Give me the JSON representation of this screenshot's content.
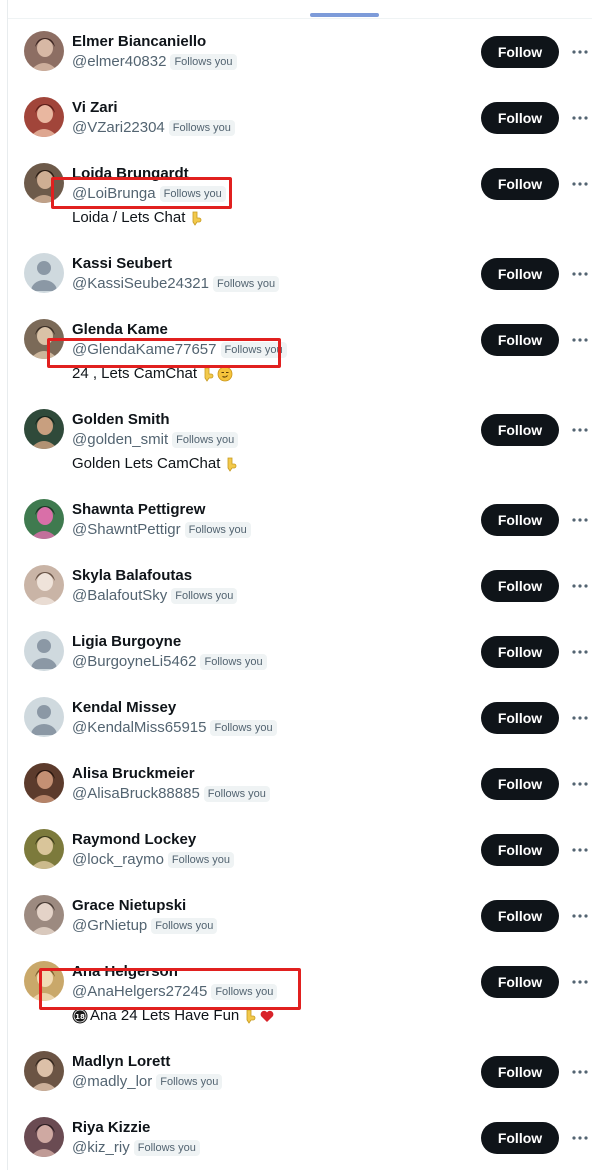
{
  "colors": {
    "follow_bg": "#0f1419",
    "follow_text": "#ffffff",
    "handle": "#536471",
    "badge_bg": "#eff3f4",
    "highlight": "#e1201f",
    "tab_indicator": "#7d9bd9"
  },
  "labels": {
    "follow": "Follow",
    "follows_you": "Follows you"
  },
  "users": [
    {
      "name": "Elmer Biancaniello",
      "handle": "@elmer40832",
      "follows_you": true,
      "bio": "",
      "avatar": "photo"
    },
    {
      "name": "Vi Zari",
      "handle": "@VZari22304",
      "follows_you": true,
      "bio": "",
      "avatar": "photo"
    },
    {
      "name": "Loida Brungardt",
      "handle": "@LoiBrunga",
      "follows_you": true,
      "bio": "Loida / Lets Chat",
      "bio_emoji_after": [
        "backhand-index-pointing-down"
      ],
      "highlighted": true,
      "avatar": "photo"
    },
    {
      "name": "Kassi Seubert",
      "handle": "@KassiSeube24321",
      "follows_you": true,
      "bio": "",
      "avatar": "default"
    },
    {
      "name": "Glenda Kame",
      "handle": "@GlendaKame77657",
      "follows_you": true,
      "bio": "24 , Lets CamChat",
      "bio_emoji_after": [
        "backhand-index-pointing-down",
        "smirking-face"
      ],
      "highlighted": true,
      "avatar": "photo"
    },
    {
      "name": "Golden Smith",
      "handle": "@golden_smit",
      "follows_you": true,
      "bio": "Golden Lets CamChat",
      "bio_emoji_after": [
        "backhand-index-pointing-down"
      ],
      "avatar": "photo"
    },
    {
      "name": "Shawnta Pettigrew",
      "handle": "@ShawntPettigr",
      "follows_you": true,
      "bio": "",
      "avatar": "photo"
    },
    {
      "name": "Skyla Balafoutas",
      "handle": "@BalafoutSky",
      "follows_you": true,
      "bio": "",
      "avatar": "photo"
    },
    {
      "name": "Ligia Burgoyne",
      "handle": "@BurgoyneLi5462",
      "follows_you": true,
      "bio": "",
      "avatar": "default"
    },
    {
      "name": "Kendal Missey",
      "handle": "@KendalMiss65915",
      "follows_you": true,
      "bio": "",
      "avatar": "default"
    },
    {
      "name": "Alisa Bruckmeier",
      "handle": "@AlisaBruck88885",
      "follows_you": true,
      "bio": "",
      "avatar": "photo"
    },
    {
      "name": "Raymond Lockey",
      "handle": "@lock_raymo",
      "follows_you": true,
      "bio": "",
      "avatar": "photo"
    },
    {
      "name": "Grace Nietupski",
      "handle": "@GrNietup",
      "follows_you": true,
      "bio": "",
      "avatar": "photo"
    },
    {
      "name": "Ana Helgerson",
      "handle": "@AnaHelgers27245",
      "follows_you": true,
      "bio": "Ana 24 Lets Have Fun",
      "bio_emoji_before": [
        "no-one-under-eighteen"
      ],
      "bio_emoji_after": [
        "backhand-index-pointing-down",
        "red-heart"
      ],
      "highlighted": true,
      "avatar": "photo"
    },
    {
      "name": "Madlyn Lorett",
      "handle": "@madly_lor",
      "follows_you": true,
      "bio": "",
      "avatar": "photo"
    },
    {
      "name": "Riya Kizzie",
      "handle": "@kiz_riy",
      "follows_you": true,
      "bio": "",
      "avatar": "photo"
    }
  ]
}
